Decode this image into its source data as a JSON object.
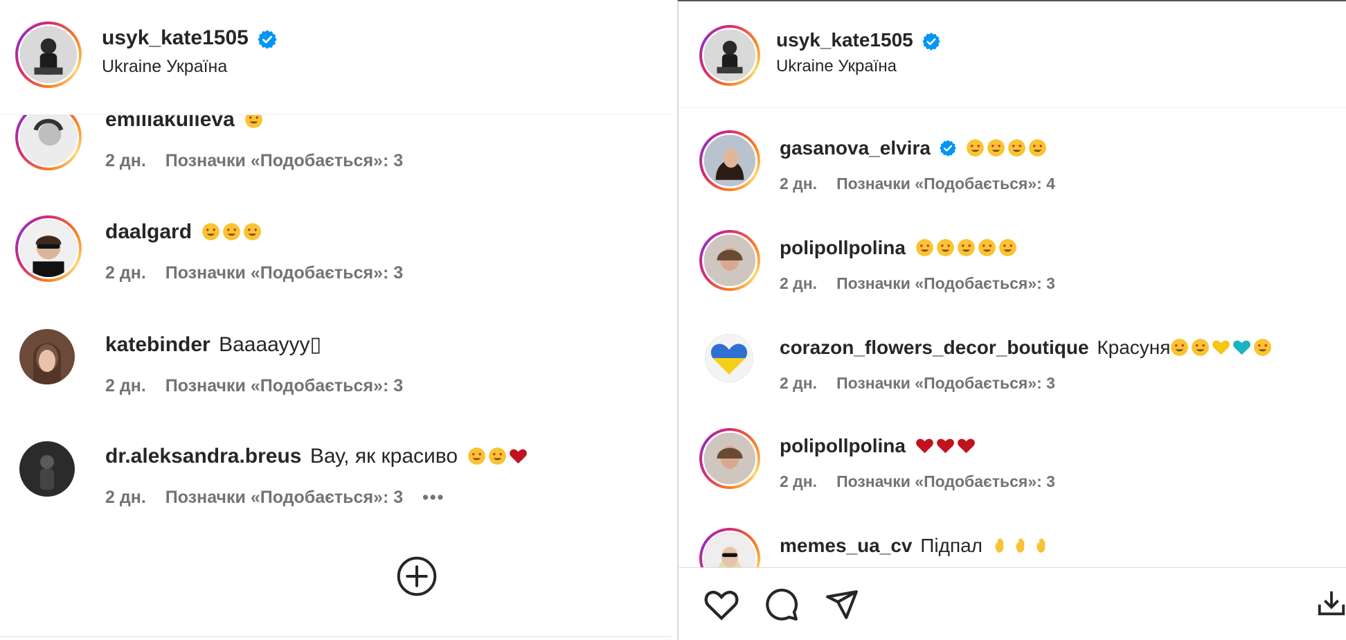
{
  "left": {
    "header": {
      "username": "usyk_kate1505",
      "location": "Ukraine Україна"
    },
    "comments": [
      {
        "user": "emiliakulieva",
        "text": "",
        "emoji": [
          "smile-hearts"
        ],
        "time": "2 дн.",
        "likes": "Позначки «Подобається»: 3"
      },
      {
        "user": "daalgard",
        "text": "",
        "emoji": [
          "smile-hearts",
          "smile-hearts",
          "smile-hearts"
        ],
        "time": "2 дн.",
        "likes": "Позначки «Подобається»: 3"
      },
      {
        "user": "katebinder",
        "text": "Вааааууу▯",
        "emoji": [],
        "time": "2 дн.",
        "likes": "Позначки «Подобається»: 3"
      },
      {
        "user": "dr.aleksandra.breus",
        "text": "Вау, як красиво",
        "emoji": [
          "smile-hearts",
          "smile-hearts",
          "red-heart"
        ],
        "time": "2 дн.",
        "likes": "Позначки «Подобається»: 3",
        "more": "•••"
      }
    ]
  },
  "right": {
    "header": {
      "username": "usyk_kate1505",
      "location": "Ukraine Україна"
    },
    "comments": [
      {
        "user": "gasanova_elvira",
        "text": "",
        "emoji": [
          "smile-hearts",
          "smile-hearts",
          "smile-hearts",
          "smile-hearts"
        ],
        "time": "2 дн.",
        "likes": "Позначки «Подобається»: 4"
      },
      {
        "user": "polipollpolina",
        "text": "",
        "emoji": [
          "smile-hearts",
          "smile-hearts",
          "smile-hearts",
          "smile-hearts",
          "smile-hearts"
        ],
        "time": "2 дн.",
        "likes": "Позначки «Подобається»: 3"
      },
      {
        "user": "corazon_flowers_decor_boutique",
        "text": "Красуня",
        "emoji": [
          "smile-hearts",
          "smile-hearts",
          "yellow-heart",
          "teal-heart",
          "smile-hearts"
        ],
        "time": "2 дн.",
        "likes": "Позначки «Подобається»: 3"
      },
      {
        "user": "polipollpolina",
        "text": "",
        "emoji": [
          "red-heart",
          "red-heart",
          "red-heart"
        ],
        "time": "2 дн.",
        "likes": "Позначки «Подобається»: 3"
      },
      {
        "user": "memes_ua_cv",
        "text": "Підпал",
        "emoji": [
          "waving-hand",
          "waving-hand",
          "waving-hand"
        ],
        "time": "",
        "likes": ""
      }
    ]
  },
  "icons": {
    "verified": "verified-badge-icon",
    "add": "plus-circle-icon",
    "like": "heart-icon",
    "comment": "comment-icon",
    "share": "send-icon",
    "save": "download-icon"
  },
  "colors": {
    "verified": "#0095f6",
    "muted": "#737373",
    "text": "#262626",
    "heart": "#c0121f"
  }
}
